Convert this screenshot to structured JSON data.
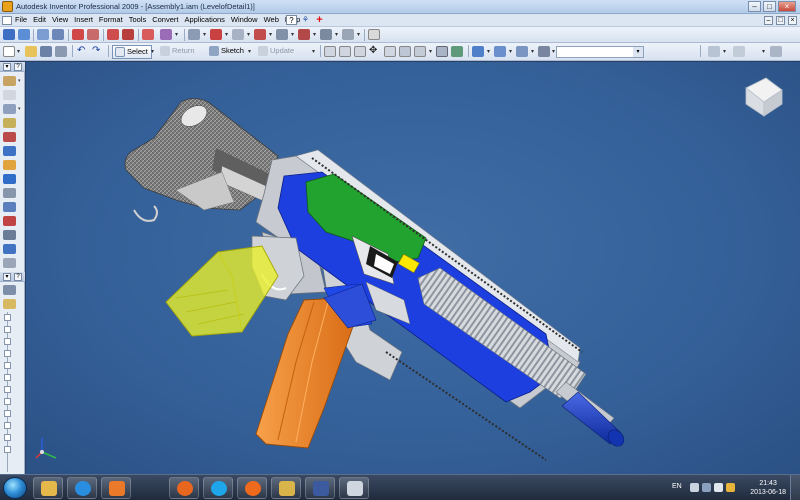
{
  "window": {
    "title": "Autodesk Inventor Professional 2009 - [Assembly1.iam (LevelofDetail1)]",
    "min_symbol": "–",
    "max_symbol": "□",
    "close_symbol": "×"
  },
  "menubar": {
    "items": [
      "File",
      "Edit",
      "View",
      "Insert",
      "Format",
      "Tools",
      "Convert",
      "Applications",
      "Window",
      "Web",
      "Help"
    ],
    "help_icon": "?",
    "plus_icon": "+",
    "mdi_min": "–",
    "mdi_max": "□",
    "mdi_close": "×"
  },
  "toolbar2": {
    "select_label": "Select",
    "return_label": "Return",
    "sketch_label": "Sketch",
    "update_label": "Update",
    "combo_value": ""
  },
  "colors": {
    "stock": "#6c6c6c",
    "receiver": "#c8ccd2",
    "handguard_blue": "#1d3fe0",
    "bolt_green": "#22a22f",
    "grip_yellow": "#e8ef2a",
    "magazine_orange": "#f08a2a",
    "barrel_blue": "#1b3fc0",
    "viewport_bg": "#35619a"
  },
  "taskbar": {
    "apps": [
      "windows-explorer",
      "internet-explorer",
      "media-player",
      "firefox",
      "skype",
      "firefox-2",
      "autodesk-inventor",
      "inventor-viewer",
      "paint"
    ],
    "language": "EN",
    "time": "21:43",
    "date": "2013-06-18"
  }
}
